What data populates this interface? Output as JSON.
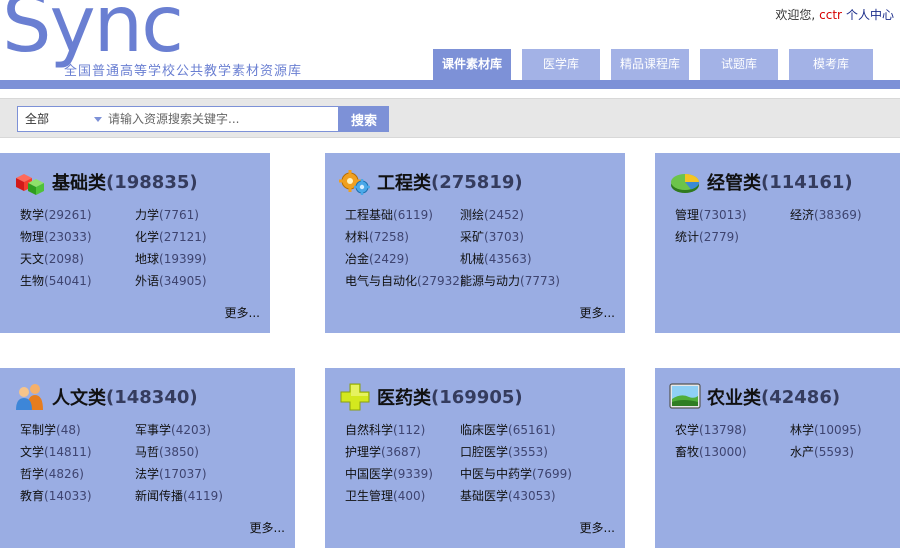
{
  "header": {
    "logo": "Sync",
    "subtitle": "全国普通高等学校公共教学素材资源库",
    "welcome": "欢迎您,",
    "username": "cctr",
    "profile": "个人中心"
  },
  "nav": {
    "tabs": [
      {
        "label": "课件素材库",
        "active": true
      },
      {
        "label": "医学库"
      },
      {
        "label": "精品课程库"
      },
      {
        "label": "试题库"
      },
      {
        "label": "模考库"
      }
    ]
  },
  "search": {
    "category": "全部",
    "placeholder": "请输入资源搜索关键字...",
    "button": "搜索"
  },
  "colors": {
    "accent": "#7d91d7",
    "tab": "#a3b2e6",
    "card": "#9aade3",
    "username": "#d60000"
  },
  "categories": [
    {
      "title": "基础类",
      "count": "(198835)",
      "icon": "cube-icon",
      "items": [
        {
          "name": "数学",
          "count": "(29261)"
        },
        {
          "name": "力学",
          "count": "(7761)"
        },
        {
          "name": "物理",
          "count": "(23033)"
        },
        {
          "name": "化学",
          "count": "(27121)"
        },
        {
          "name": "天文",
          "count": "(2098)"
        },
        {
          "name": "地球",
          "count": "(19399)"
        },
        {
          "name": "生物",
          "count": "(54041)"
        },
        {
          "name": "外语",
          "count": "(34905)"
        }
      ],
      "more": "更多..."
    },
    {
      "title": "工程类",
      "count": "(275819)",
      "icon": "gears-icon",
      "items": [
        {
          "name": "工程基础",
          "count": "(6119)"
        },
        {
          "name": "测绘",
          "count": "(2452)"
        },
        {
          "name": "材料",
          "count": "(7258)"
        },
        {
          "name": "采矿",
          "count": "(3703)"
        },
        {
          "name": "冶金",
          "count": "(2429)"
        },
        {
          "name": "机械",
          "count": "(43563)"
        },
        {
          "name": "电气与自动化",
          "count": "(27932)"
        },
        {
          "name": "能源与动力",
          "count": "(7773)"
        }
      ],
      "more": "更多..."
    },
    {
      "title": "经管类",
      "count": "(114161)",
      "icon": "pie-chart-icon",
      "items": [
        {
          "name": "管理",
          "count": "(73013)"
        },
        {
          "name": "经济",
          "count": "(38369)"
        },
        {
          "name": "统计",
          "count": "(2779)"
        }
      ],
      "more": ""
    },
    {
      "title": "人文类",
      "count": "(148340)",
      "icon": "people-icon",
      "items": [
        {
          "name": "军制学",
          "count": "(48)"
        },
        {
          "name": "军事学",
          "count": "(4203)"
        },
        {
          "name": "文学",
          "count": "(14811)"
        },
        {
          "name": "马哲",
          "count": "(3850)"
        },
        {
          "name": "哲学",
          "count": "(4826)"
        },
        {
          "name": "法学",
          "count": "(17037)"
        },
        {
          "name": "教育",
          "count": "(14033)"
        },
        {
          "name": "新闻传播",
          "count": "(4119)"
        }
      ],
      "more": "更多..."
    },
    {
      "title": "医药类",
      "count": "(169905)",
      "icon": "medical-cross-icon",
      "items": [
        {
          "name": "自然科学",
          "count": "(112)"
        },
        {
          "name": "临床医学",
          "count": "(65161)"
        },
        {
          "name": "护理学",
          "count": "(3687)"
        },
        {
          "name": "口腔医学",
          "count": "(3553)"
        },
        {
          "name": "中国医学",
          "count": "(9339)"
        },
        {
          "name": "中医与中药学",
          "count": "(7699)"
        },
        {
          "name": "卫生管理",
          "count": "(400)"
        },
        {
          "name": "基础医学",
          "count": "(43053)"
        }
      ],
      "more": "更多..."
    },
    {
      "title": "农业类",
      "count": "(42486)",
      "icon": "landscape-icon",
      "items": [
        {
          "name": "农学",
          "count": "(13798)"
        },
        {
          "name": "林学",
          "count": "(10095)"
        },
        {
          "name": "畜牧",
          "count": "(13000)"
        },
        {
          "name": "水产",
          "count": "(5593)"
        }
      ],
      "more": ""
    }
  ]
}
